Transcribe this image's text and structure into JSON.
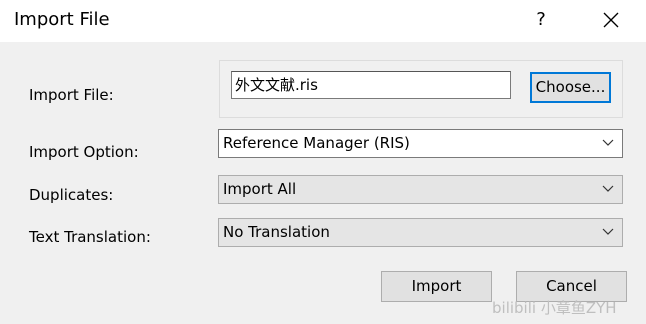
{
  "window": {
    "title": "Import File",
    "help_label": "?",
    "close_icon": "close-icon"
  },
  "form": {
    "import_file_label": "Import File:",
    "import_file_value": "外文文献.ris",
    "choose_label": "Choose...",
    "import_option_label": "Import Option:",
    "import_option_value": "Reference Manager (RIS)",
    "duplicates_label": "Duplicates:",
    "duplicates_value": "Import All",
    "translation_label": "Text Translation:",
    "translation_value": "No Translation"
  },
  "buttons": {
    "import_label": "Import",
    "cancel_label": "Cancel"
  },
  "watermark": {
    "text": "bilibili 小章鱼ZYH"
  },
  "colors": {
    "focus_border": "#0078d7",
    "dialog_bg": "#f0f0f0"
  }
}
